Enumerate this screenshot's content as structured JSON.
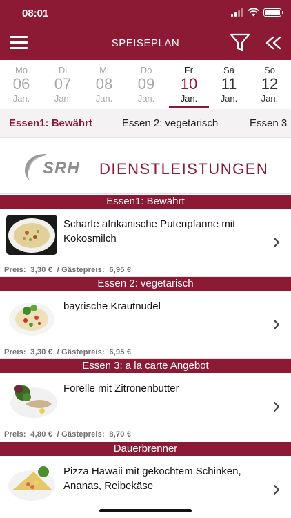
{
  "status_bar": {
    "time": "08:01"
  },
  "header": {
    "title": "SPEISEPLAN"
  },
  "colors": {
    "brand": "#8c1a34",
    "muted_text": "#a8a8a8",
    "tab_bg": "#f4f2f2"
  },
  "dates": [
    {
      "dow": "Mo",
      "day": "06",
      "month": "Jan."
    },
    {
      "dow": "Di",
      "day": "07",
      "month": "Jan."
    },
    {
      "dow": "Mi",
      "day": "08",
      "month": "Jan."
    },
    {
      "dow": "Do",
      "day": "09",
      "month": "Jan."
    },
    {
      "dow": "Fr",
      "day": "10",
      "month": "Jan."
    },
    {
      "dow": "Sa",
      "day": "11",
      "month": "Jan."
    },
    {
      "dow": "So",
      "day": "12",
      "month": "Jan."
    }
  ],
  "selected_date_index": 4,
  "tabs": [
    {
      "label": "Essen1: Bewährt"
    },
    {
      "label": "Essen 2: vegetarisch"
    },
    {
      "label": "Essen 3"
    }
  ],
  "logo": {
    "srh": "SRH",
    "text": "DIENSTLEISTUNGEN"
  },
  "sections": [
    {
      "title": "Essen1: Bewährt",
      "meal": {
        "title": "Scharfe afrikanische Putenpfanne mit Kokosmilch",
        "price_label": "Preis:",
        "price": "3,30 €",
        "guest_label": "/ Gästepreis:",
        "guest_price": "6,95 €",
        "image": "food-photo-rice-dish"
      }
    },
    {
      "title": "Essen 2: vegetarisch",
      "meal": {
        "title": "bayrische Krautnudel",
        "price_label": "Preis:",
        "price": "3,30 €",
        "guest_label": "/ Gästepreis:",
        "guest_price": "6,95 €",
        "image": "food-photo-pasta-salad"
      }
    },
    {
      "title": "Essen 3: a la carte Angebot",
      "meal": {
        "title": "Forelle mit Zitronenbutter",
        "price_label": "Preis:",
        "price": "4,80 €",
        "guest_label": "/ Gästepreis:",
        "guest_price": "8,70 €",
        "image": "food-photo-fish-plate"
      }
    },
    {
      "title": "Dauerbrenner",
      "meal": {
        "title": "Pizza Hawaii mit gekochtem Schinken, Ananas, Reibekäse",
        "image": "food-photo-pizza"
      }
    }
  ]
}
